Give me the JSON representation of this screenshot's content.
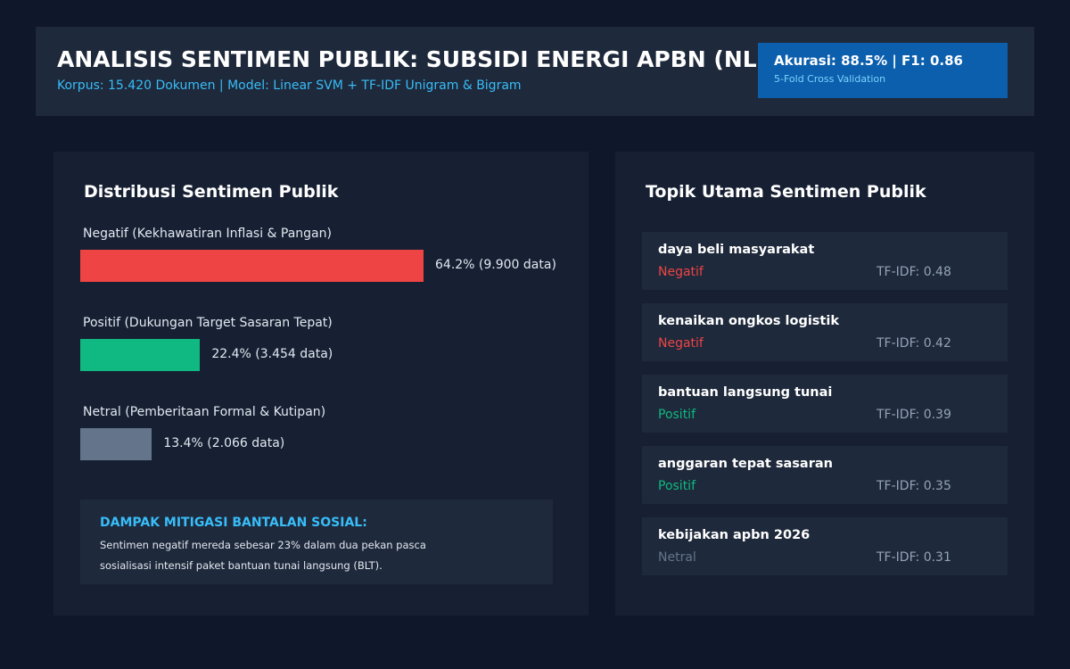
{
  "header": {
    "title": "ANALISIS SENTIMEN PUBLIK: SUBSIDI ENERGI APBN (NLP)",
    "subtitle": "Korpus: 15.420 Dokumen | Model: Linear SVM + TF-IDF Unigram & Bigram",
    "metric_main": "Akurasi: 88.5% | F1: 0.86",
    "metric_sub": "5-Fold Cross Validation"
  },
  "chart_data": {
    "type": "bar",
    "orientation": "horizontal",
    "title": "Distribusi Sentimen Publik",
    "categories": [
      "Negatif (Kekhawatiran Inflasi & Pangan)",
      "Positif (Dukungan Target Sasaran Tepat)",
      "Netral (Pemberitaan Formal & Kutipan)"
    ],
    "values": [
      64.2,
      22.4,
      13.4
    ],
    "value_labels": [
      "64.2% (9.900 data)",
      "22.4% (3.454 data)",
      "13.4% (2.066 data)"
    ],
    "colors": [
      "#ef4444",
      "#10b981",
      "#64748b"
    ],
    "grid": false
  },
  "note": {
    "title": "DAMPAK MITIGASI BANTALAN SOSIAL:",
    "text": "Sentimen negatif mereda sebesar 23% dalam dua pekan pasca sosialisasi intensif paket bantuan tunai langsung (BLT)."
  },
  "topics": {
    "title": "Topik Utama Sentimen Publik",
    "items": [
      {
        "name": "daya beli masyarakat",
        "sentiment": "Negatif",
        "score": "TF-IDF: 0.48",
        "color": "#ef4444"
      },
      {
        "name": "kenaikan ongkos logistik",
        "sentiment": "Negatif",
        "score": "TF-IDF: 0.42",
        "color": "#ef4444"
      },
      {
        "name": "bantuan langsung tunai",
        "sentiment": "Positif",
        "score": "TF-IDF: 0.39",
        "color": "#10b981"
      },
      {
        "name": "anggaran tepat sasaran",
        "sentiment": "Positif",
        "score": "TF-IDF: 0.35",
        "color": "#10b981"
      },
      {
        "name": "kebijakan apbn 2026",
        "sentiment": "Netral",
        "score": "TF-IDF: 0.31",
        "color": "#64748b"
      }
    ]
  }
}
